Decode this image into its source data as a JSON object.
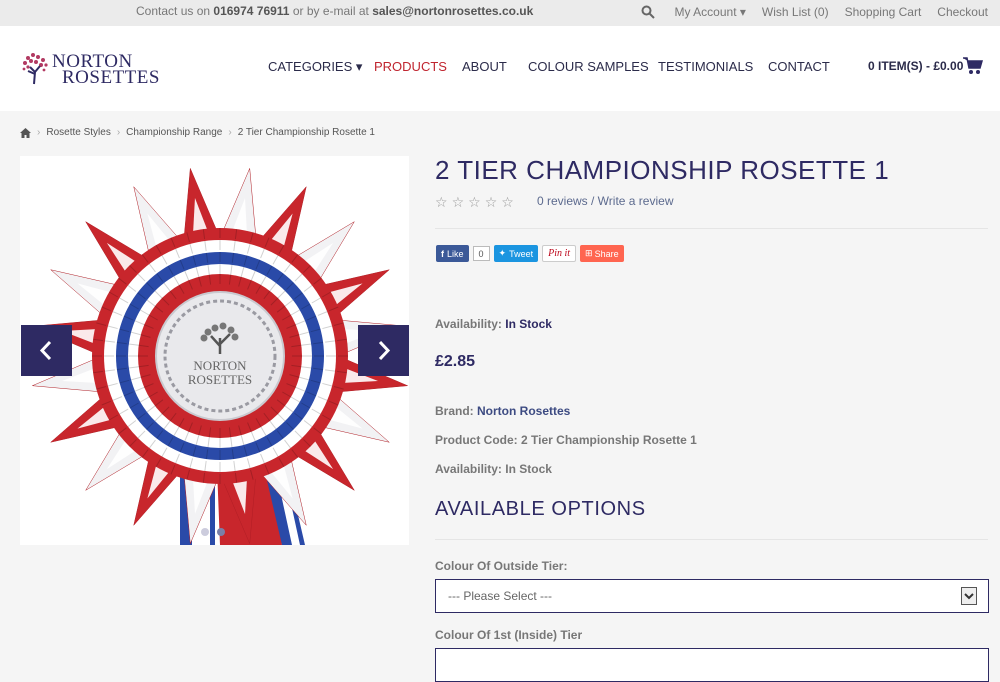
{
  "topbar": {
    "contact_prefix": "Contact us on",
    "phone": "016974 76911",
    "contact_mid": "or by e-mail at",
    "email": "sales@nortonrosettes.co.uk",
    "my_account": "My Account ▾",
    "wish_list": "Wish List (0)",
    "shopping_cart": "Shopping Cart",
    "checkout": "Checkout"
  },
  "brand": {
    "line1": "NORTON",
    "line2": "ROSETTES"
  },
  "nav": {
    "categories": "CATEGORIES ▾",
    "products": "PRODUCTS",
    "about": "ABOUT",
    "colour_samples": "COLOUR SAMPLES",
    "testimonials": "TESTIMONIALS",
    "contact": "CONTACT"
  },
  "cart": {
    "label": "0 ITEM(S) - £0.00"
  },
  "breadcrumb": [
    "Rosette Styles",
    "Championship Range",
    "2 Tier Championship Rosette 1"
  ],
  "gallery": {
    "logo_line1": "NORTON",
    "logo_line2": "ROSETTES",
    "slide_count": 2,
    "active_slide": 2
  },
  "product": {
    "title": "2 TIER CHAMPIONSHIP ROSETTE 1",
    "rating": 0,
    "reviews": "0 reviews / Write a review",
    "social": {
      "like": "Like",
      "like_count": "0",
      "tweet": "Tweet",
      "pin": "Pin it",
      "share": "Share"
    },
    "availability_label": "Availability:",
    "availability_value": "In Stock",
    "price": "£2.85",
    "brand_label": "Brand:",
    "brand_value": "Norton Rosettes",
    "code_label": "Product Code:",
    "code_value": "2 Tier Championship Rosette 1",
    "availability2_label": "Availability:",
    "availability2_value": "In Stock"
  },
  "options": {
    "heading": "AVAILABLE OPTIONS",
    "outside_label": "Colour Of Outside Tier:",
    "outside_value": "--- Please Select ---",
    "inside_label": "Colour Of 1st (Inside) Tier"
  },
  "colors": {
    "brand_navy": "#2e2a63",
    "active_red": "#c0252f",
    "rosette_red": "#c8262c",
    "rosette_blue": "#2a4aa8"
  }
}
